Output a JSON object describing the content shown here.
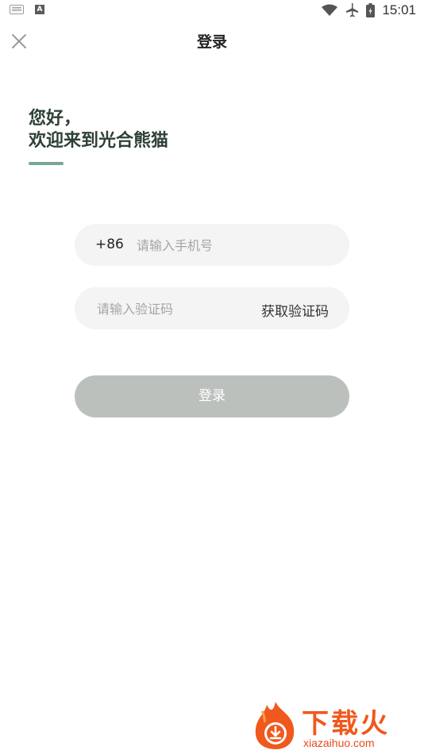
{
  "status_bar": {
    "time": "15:01",
    "left_icons": [
      "keyboard-icon",
      "a-icon"
    ],
    "right_icons": [
      "wifi-icon",
      "airplane-icon",
      "battery-icon"
    ]
  },
  "header": {
    "title": "登录",
    "close_icon": "close-icon"
  },
  "greeting": {
    "line1": "您好，",
    "line2": "欢迎来到光合熊猫",
    "accent_color": "#79a797"
  },
  "form": {
    "country_code": "+86",
    "phone_placeholder": "请输入手机号",
    "code_placeholder": "请输入验证码",
    "get_code_label": "获取验证码",
    "login_label": "登录",
    "login_disabled_color": "#bbc0bd"
  },
  "watermark": {
    "title": "下载火",
    "url": "xiazaihuo.com",
    "brand_color": "#f0581d"
  }
}
